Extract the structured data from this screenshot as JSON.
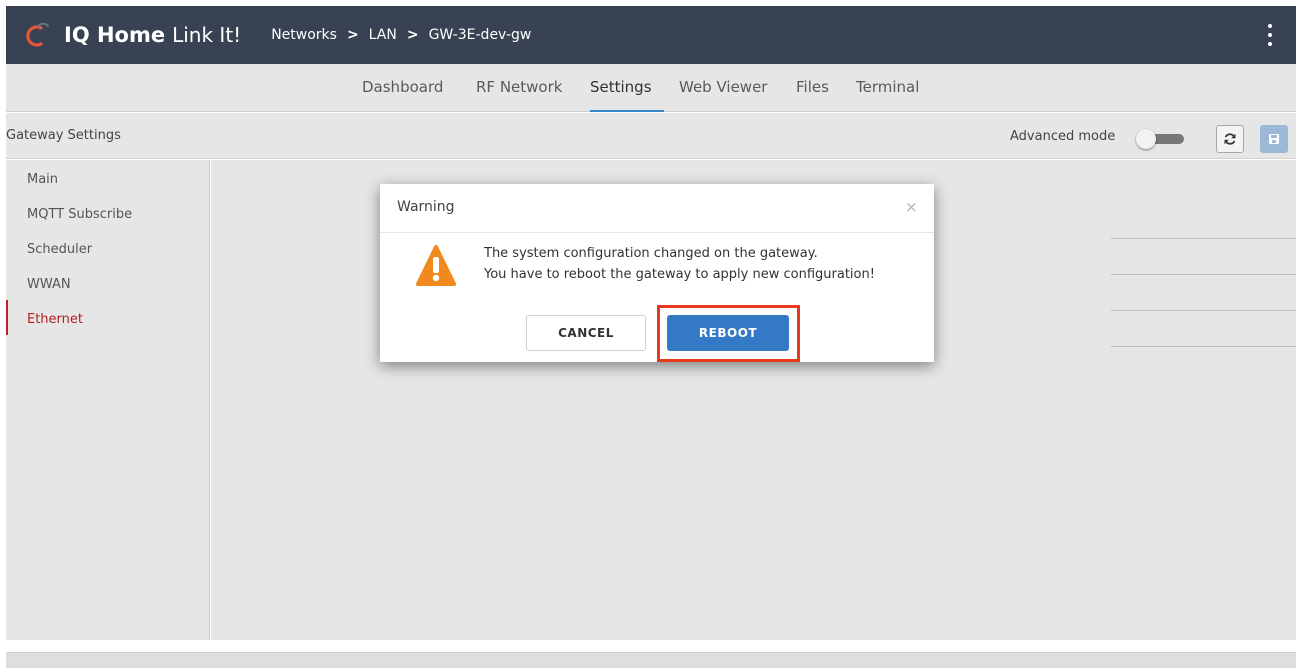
{
  "header": {
    "brand_strong": "IQ Home",
    "brand_light": "Link It!",
    "breadcrumb": [
      "Networks",
      "LAN",
      "GW-3E-dev-gw"
    ],
    "breadcrumb_separator": ">",
    "menu_icon": "vertical-dots-icon",
    "logo_color": "#e8553a"
  },
  "tabs": {
    "items": [
      "Dashboard",
      "RF Network",
      "Settings",
      "Web Viewer",
      "Files",
      "Terminal"
    ],
    "active": "Settings",
    "accent": "#3b88c8"
  },
  "subbar": {
    "title": "Gateway Settings",
    "advanced_label": "Advanced mode",
    "advanced_enabled": false,
    "refresh_icon": "refresh-icon",
    "save_icon": "save-icon"
  },
  "sidebar": {
    "items": [
      "Main",
      "MQTT Subscribe",
      "Scheduler",
      "WWAN",
      "Ethernet"
    ],
    "active": "Ethernet",
    "active_color": "#b32020"
  },
  "dialog": {
    "title": "Warning",
    "close_glyph": "×",
    "warning_icon": "warning-triangle-icon",
    "warning_color": "#f08a1c",
    "line1": "The system configuration changed on the gateway.",
    "line2": "You have to reboot the gateway to apply new configuration!",
    "cancel_label": "CANCEL",
    "reboot_label": "REBOOT",
    "primary_color": "#3479c5",
    "highlight_color": "#e8381d"
  }
}
